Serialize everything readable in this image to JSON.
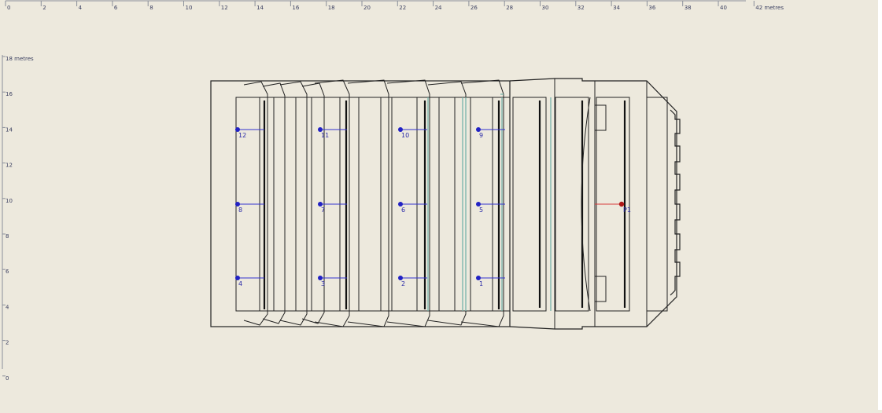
{
  "x_ruler": {
    "labels": [
      "0",
      "2",
      "4",
      "6",
      "8",
      "10",
      "12",
      "14",
      "16",
      "18",
      "20",
      "22",
      "24",
      "26",
      "28",
      "30",
      "32",
      "34",
      "36",
      "38",
      "40",
      "42 metres"
    ]
  },
  "y_ruler": {
    "labels": [
      "18 metres",
      "16",
      "14",
      "12",
      "10",
      "8",
      "6",
      "4",
      "2",
      "0"
    ]
  },
  "receivers": [
    {
      "label": "12"
    },
    {
      "label": "11"
    },
    {
      "label": "10"
    },
    {
      "label": "9"
    },
    {
      "label": "8"
    },
    {
      "label": "7"
    },
    {
      "label": "6"
    },
    {
      "label": "5"
    },
    {
      "label": "4"
    },
    {
      "label": "3"
    },
    {
      "label": "2"
    },
    {
      "label": "1"
    }
  ],
  "source": {
    "label": "P1"
  },
  "colors": {
    "background": "#ede9dd",
    "receiver": "#2222c4",
    "source": "#b01818",
    "outline": "#222222",
    "highlight": "#6fb0a6"
  }
}
